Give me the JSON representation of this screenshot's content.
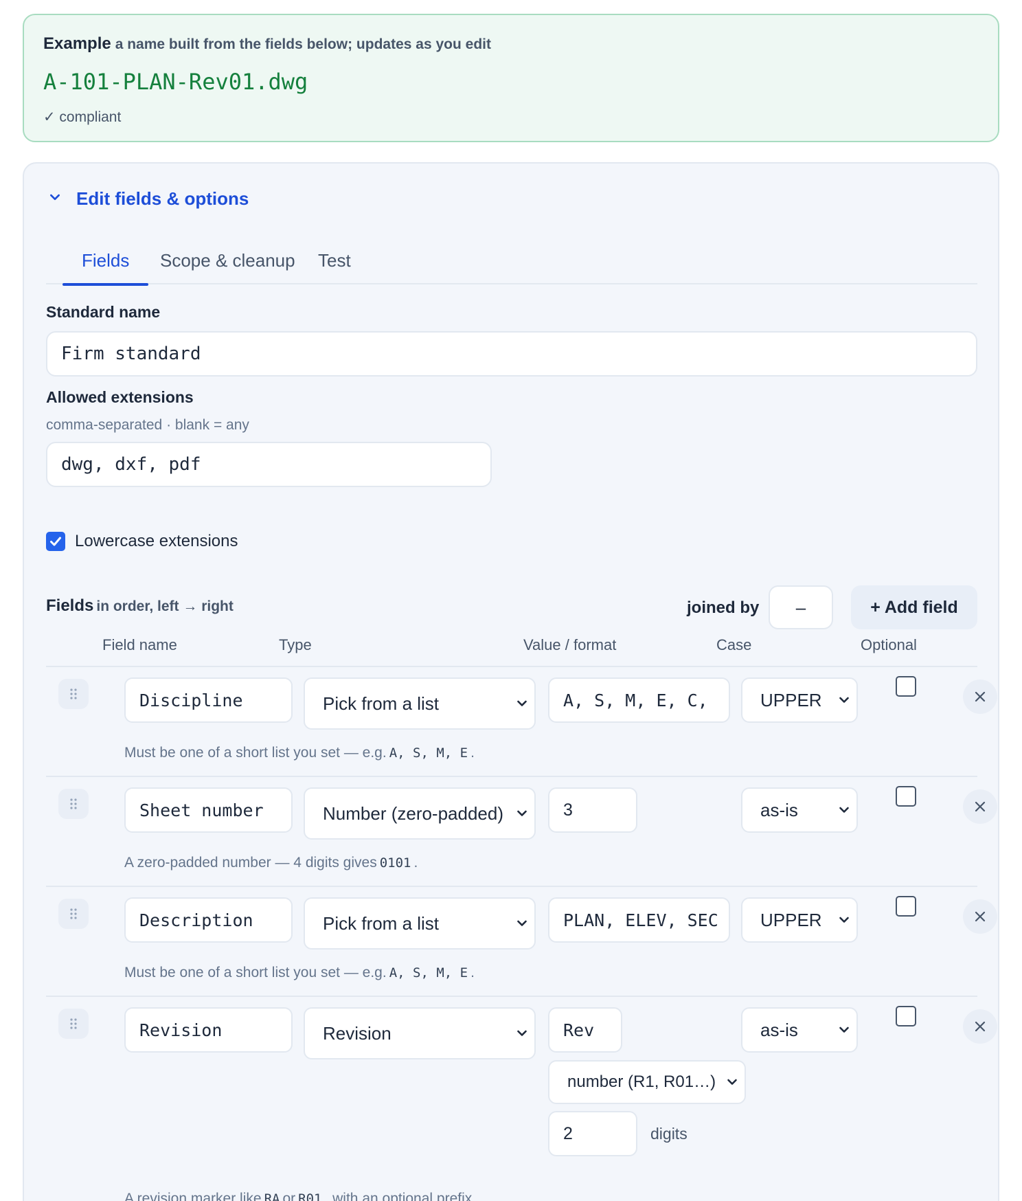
{
  "example": {
    "label": "Example",
    "subtitle": "a name built from the fields below; updates as you edit",
    "name": "A-101-PLAN-Rev01.dwg",
    "status": "✓ compliant"
  },
  "panel": {
    "toggle_label": "Edit fields & options",
    "tabs": [
      {
        "label": "Fields",
        "active": true
      },
      {
        "label": "Scope & cleanup",
        "active": false
      },
      {
        "label": "Test",
        "active": false
      }
    ]
  },
  "standard": {
    "label": "Standard name",
    "value": "Firm standard"
  },
  "extensions": {
    "label": "Allowed extensions",
    "hint": "comma-separated · blank = any",
    "value": "dwg, dxf, pdf",
    "lowercase_label": "Lowercase extensions",
    "lowercase_checked": true
  },
  "fields": {
    "title": "Fields",
    "subtitle": "in order, left → right",
    "joined_label": "joined by",
    "separator": "–",
    "add_label": "+ Add field",
    "columns": [
      "Field name",
      "Type",
      "Value / format",
      "Case",
      "Optional"
    ],
    "rows": [
      {
        "name": "Discipline",
        "type": "Pick from a list",
        "value": "A, S, M, E, C,",
        "case": "UPPER",
        "optional": false,
        "desc_pre": "Must be one of a short list you set — e.g.",
        "desc_code": "A, S, M, E",
        "desc_post": "."
      },
      {
        "name": "Sheet number",
        "type": "Number (zero-padded)",
        "value": "3",
        "case": "as-is",
        "optional": false,
        "desc_pre": "A zero-padded number — 4 digits gives",
        "desc_code": "0101",
        "desc_post": "."
      },
      {
        "name": "Description",
        "type": "Pick from a list",
        "value": "PLAN, ELEV, SEC",
        "case": "UPPER",
        "optional": false,
        "desc_pre": "Must be one of a short list you set — e.g.",
        "desc_code": "A, S, M, E",
        "desc_post": "."
      },
      {
        "name": "Revision",
        "type": "Revision",
        "value": "Rev",
        "case": "as-is",
        "optional": false,
        "rev_style": "number (R1, R01…)",
        "digits_value": "2",
        "digits_label": "digits",
        "desc_pre": "A revision marker like",
        "desc_code": "RA",
        "desc_mid": "or",
        "desc_code2": "R01",
        "desc_post": ", with an optional prefix."
      }
    ]
  }
}
